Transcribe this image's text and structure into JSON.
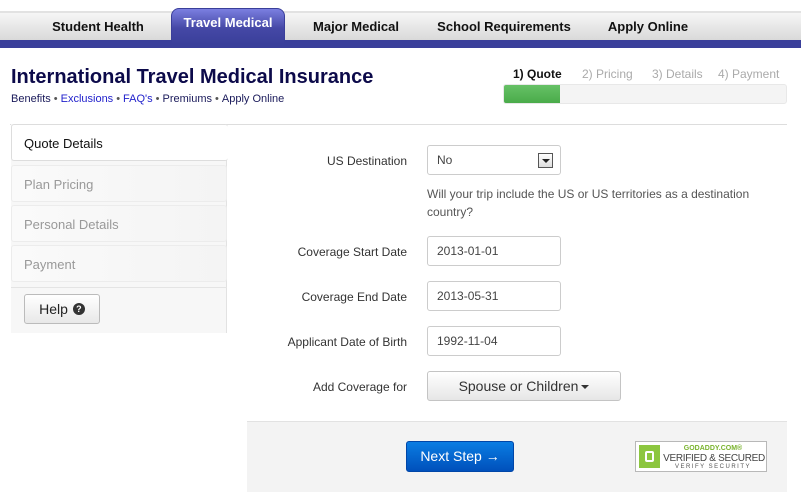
{
  "topnav": {
    "items": [
      {
        "label": "Student Health"
      },
      {
        "label": "Travel Medical",
        "active": true
      },
      {
        "label": "Major Medical"
      },
      {
        "label": "School Requirements"
      },
      {
        "label": "Apply Online"
      }
    ],
    "accent_color": "#3a3f9a"
  },
  "header": {
    "title": "International Travel Medical Insurance",
    "links": [
      "Benefits",
      "Exclusions",
      "FAQ's",
      "Premiums",
      "Apply Online"
    ],
    "separator": "•"
  },
  "progress": {
    "steps": [
      "1) Quote",
      "2) Pricing",
      "3) Details",
      "4) Payment"
    ],
    "active_step": 1,
    "fill_fraction": 0.2,
    "fill_color": "#5cb85c"
  },
  "sidebar": {
    "items": [
      {
        "label": "Quote Details",
        "active": true
      },
      {
        "label": "Plan Pricing"
      },
      {
        "label": "Personal Details"
      },
      {
        "label": "Payment"
      }
    ],
    "help_label": "Help",
    "help_icon": "?"
  },
  "form": {
    "us_destination": {
      "label": "US Destination",
      "value": "No",
      "help": "Will your trip include the US or US territories as a destination country?"
    },
    "start_date": {
      "label": "Coverage Start Date",
      "value": "2013-01-01"
    },
    "end_date": {
      "label": "Coverage End Date",
      "value": "2013-05-31"
    },
    "dob": {
      "label": "Applicant Date of Birth",
      "value": "1992-11-04"
    },
    "add_coverage": {
      "label": "Add Coverage for",
      "button": "Spouse or Children"
    }
  },
  "footer": {
    "next_label": "Next Step",
    "next_icon": "→",
    "badge": {
      "line1": "GODADDY.COM®",
      "line2": "VERIFIED & SECURED",
      "line3": "VERIFY SECURITY"
    }
  }
}
